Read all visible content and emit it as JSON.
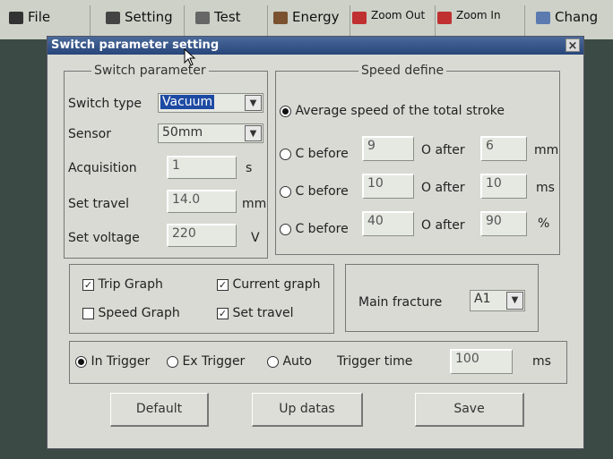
{
  "toolbar": {
    "items": [
      {
        "label": "File",
        "icon": "app-icon"
      },
      {
        "label": "Setting",
        "icon": "setting-icon"
      },
      {
        "label": "Test",
        "icon": "test-icon"
      },
      {
        "label": "Energy",
        "icon": "energy-icon"
      },
      {
        "label": "Zoom Out",
        "icon": "zoom-out-icon"
      },
      {
        "label": "Zoom In",
        "icon": "zoom-in-icon"
      },
      {
        "label": "Chang",
        "icon": "change-icon"
      }
    ]
  },
  "dialog": {
    "title": "Switch parameter setting",
    "close": "×"
  },
  "switch_param": {
    "legend": "Switch parameter",
    "type_label": "Switch type",
    "type_value": "Vacuum",
    "sensor_label": "Sensor",
    "sensor_value": "50mm",
    "acq_label": "Acquisition",
    "acq_value": "1",
    "acq_unit": "s",
    "travel_label": "Set  travel",
    "travel_value": "14.0",
    "travel_unit": "mm",
    "voltage_label": "Set voltage",
    "voltage_value": "220",
    "voltage_unit": "V"
  },
  "speed": {
    "legend": "Speed define",
    "avg_label": "Average speed of the total stroke",
    "rows": [
      {
        "c_label": "C before",
        "c_value": "9",
        "o_label": "O after",
        "o_value": "6",
        "unit": "mm"
      },
      {
        "c_label": "C before",
        "c_value": "10",
        "o_label": "O after",
        "o_value": "10",
        "unit": "ms"
      },
      {
        "c_label": "C before",
        "c_value": "40",
        "o_label": "O after",
        "o_value": "90",
        "unit": "%"
      }
    ]
  },
  "graphs": {
    "trip": "Trip Graph",
    "current": "Current graph",
    "speed": "Speed Graph",
    "set_travel": "Set travel"
  },
  "fracture": {
    "label": "Main fracture",
    "value": "A1"
  },
  "trigger": {
    "in": "In Trigger",
    "ex": "Ex Trigger",
    "auto": "Auto",
    "time_label": "Trigger time",
    "time_value": "100",
    "time_unit": "ms"
  },
  "buttons": {
    "default": "Default",
    "up": "Up datas",
    "save": "Save"
  }
}
